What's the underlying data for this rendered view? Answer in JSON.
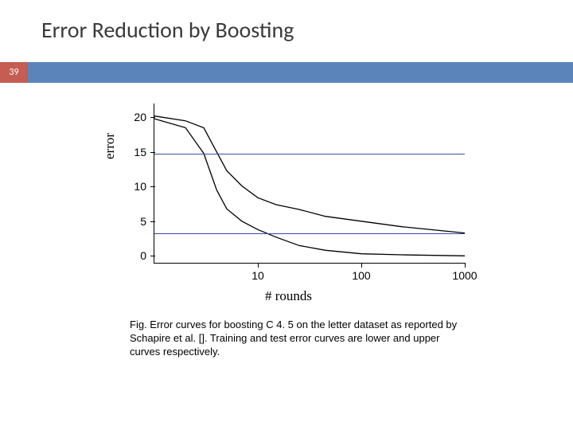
{
  "title": "Error Reduction by Boosting",
  "slide_number": "39",
  "caption": "Fig. Error curves for boosting C 4. 5 on the letter dataset as reported by Schapire et al. []. Training and test error curves are lower and upper curves respectively.",
  "chart_data": {
    "type": "line",
    "xlabel": "# rounds",
    "ylabel": "error",
    "xscale": "log",
    "xlim": [
      1,
      1000
    ],
    "ylim": [
      -1,
      22
    ],
    "xticks": [
      10,
      100,
      1000
    ],
    "yticks": [
      0,
      5,
      10,
      15,
      20
    ],
    "reference_lines": [
      {
        "name": "baseline_upper",
        "y": 14.7,
        "color": "#3a4aa0"
      },
      {
        "name": "baseline_lower",
        "y": 3.2,
        "color": "#3a4aa0"
      }
    ],
    "series": [
      {
        "name": "test_error_upper",
        "x": [
          1,
          2,
          3,
          4,
          5,
          7,
          10,
          15,
          25,
          45,
          100,
          250,
          1000
        ],
        "y": [
          20.2,
          19.5,
          18.5,
          15.0,
          12.3,
          10.1,
          8.4,
          7.4,
          6.7,
          5.7,
          5.0,
          4.2,
          3.3
        ]
      },
      {
        "name": "training_error_lower",
        "x": [
          1,
          2,
          3,
          4,
          5,
          7,
          10,
          15,
          25,
          45,
          100,
          250,
          1000
        ],
        "y": [
          19.8,
          18.5,
          14.8,
          9.5,
          6.8,
          5.0,
          3.8,
          2.7,
          1.5,
          0.8,
          0.3,
          0.15,
          0.0
        ]
      }
    ]
  }
}
